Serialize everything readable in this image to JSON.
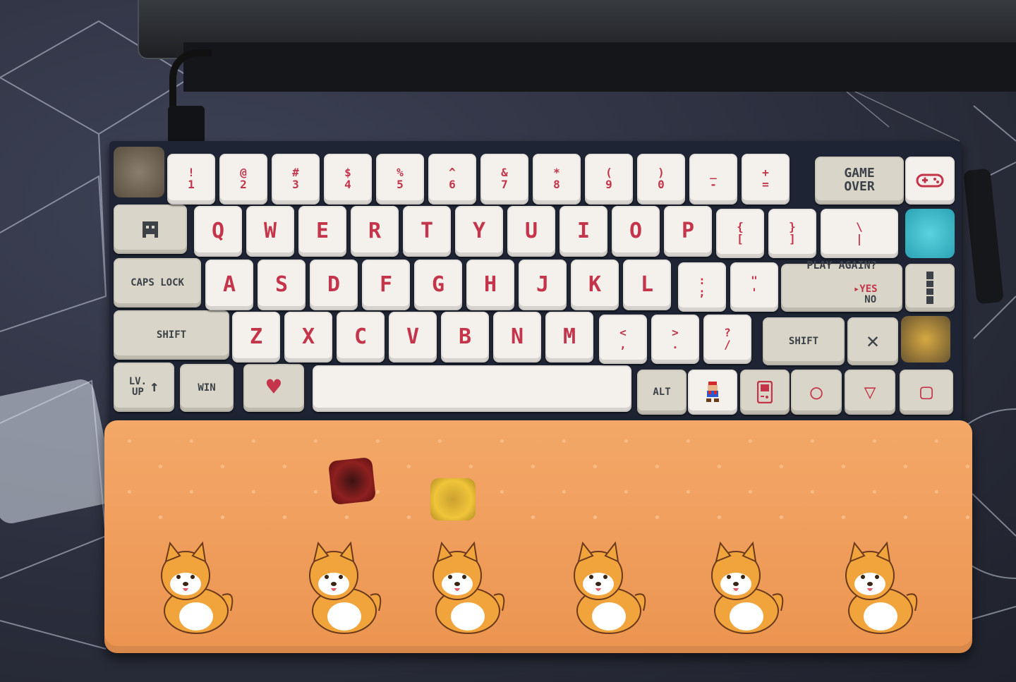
{
  "number_row": [
    {
      "top": "!",
      "bottom": "1"
    },
    {
      "top": "@",
      "bottom": "2"
    },
    {
      "top": "#",
      "bottom": "3"
    },
    {
      "top": "$",
      "bottom": "4"
    },
    {
      "top": "%",
      "bottom": "5"
    },
    {
      "top": "^",
      "bottom": "6"
    },
    {
      "top": "&",
      "bottom": "7"
    },
    {
      "top": "*",
      "bottom": "8"
    },
    {
      "top": "(",
      "bottom": "9"
    },
    {
      "top": ")",
      "bottom": "0"
    },
    {
      "top": "_",
      "bottom": "-"
    },
    {
      "top": "+",
      "bottom": "="
    }
  ],
  "game_over": "GAME\nOVER",
  "qwerty_row": [
    "Q",
    "W",
    "E",
    "R",
    "T",
    "Y",
    "U",
    "I",
    "O",
    "P"
  ],
  "qwerty_symbols": [
    "{\n[",
    "}\n]",
    "\\\n|"
  ],
  "home_row": [
    "A",
    "S",
    "D",
    "F",
    "G",
    "H",
    "J",
    "K",
    "L"
  ],
  "home_symbols": [
    ":\n;",
    "\"\n'"
  ],
  "caps_lock": "CAPS LOCK",
  "play_again": {
    "title": "PLAY AGAIN?",
    "yes": "▸YES",
    "no": "NO"
  },
  "bottom_alpha_row": [
    "Z",
    "X",
    "C",
    "V",
    "B",
    "N",
    "M"
  ],
  "bottom_symbols": [
    "<\n,",
    ">\n.",
    "?\n/"
  ],
  "shift_left": "SHIFT",
  "shift_right": "SHIFT",
  "x_key": "✕",
  "level_up": "LV.\nUP",
  "level_up_arrow": "↑",
  "win": "WIN",
  "heart": "♥",
  "alt": "ALT",
  "circle": "◯",
  "triangle": "▽",
  "square": "▢",
  "colors": {
    "legend_red": "#c4344b",
    "legend_dark": "#3c4248",
    "key_white": "#f4f1ec",
    "key_gray": "#d9d5c8",
    "wrist_rest": "#f1a060"
  }
}
